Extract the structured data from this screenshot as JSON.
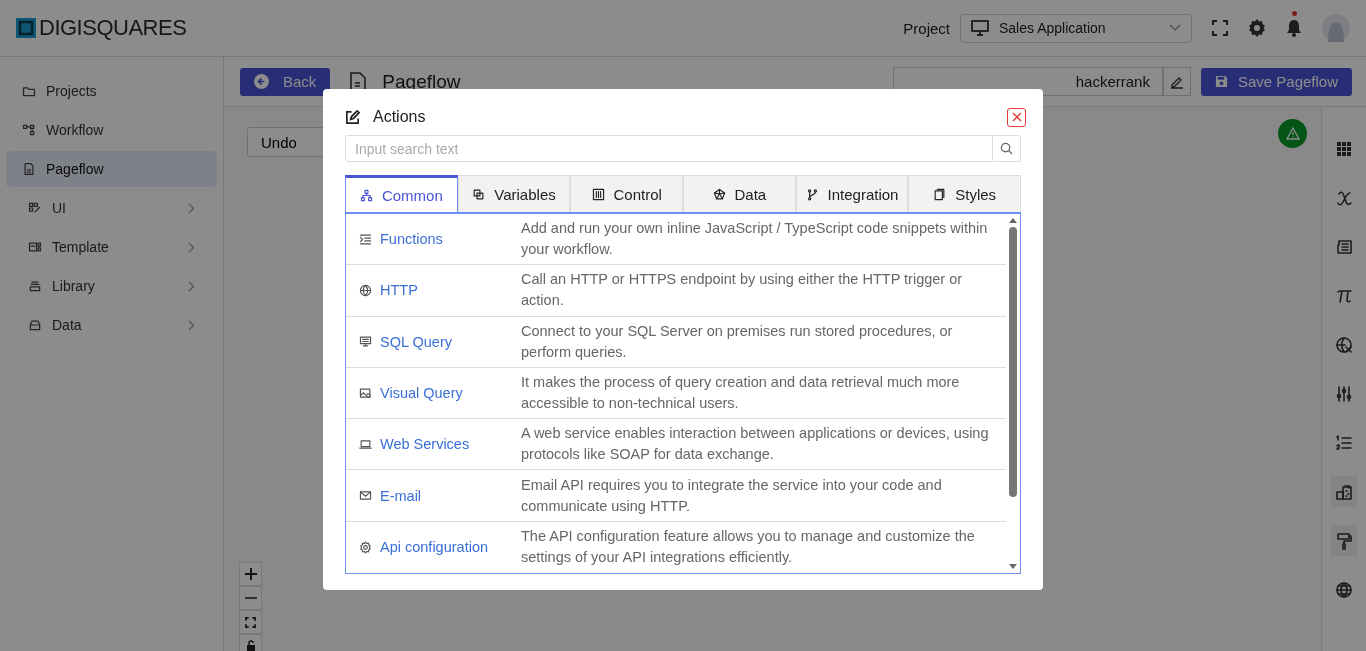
{
  "header": {
    "logo": "DIGISQUARES",
    "project_label": "Project",
    "project_select": "Sales Application",
    "unread_notifications": true
  },
  "sidebar": {
    "items": [
      {
        "label": "Projects",
        "selected": false,
        "expandable": false
      },
      {
        "label": "Workflow",
        "selected": false,
        "expandable": false
      },
      {
        "label": "Pageflow",
        "selected": true,
        "expandable": false
      },
      {
        "label": "UI",
        "selected": false,
        "expandable": true
      },
      {
        "label": "Template",
        "selected": false,
        "expandable": true
      },
      {
        "label": "Library",
        "selected": false,
        "expandable": true
      },
      {
        "label": "Data",
        "selected": false,
        "expandable": true
      }
    ]
  },
  "toolbar": {
    "back": "Back",
    "title": "Pageflow",
    "name_value": "hackerrank",
    "save": "Save Pageflow"
  },
  "canvas": {
    "undo": "Undo"
  },
  "modal": {
    "title": "Actions",
    "search": {
      "placeholder": "Input search text"
    },
    "tabs": [
      {
        "label": "Common",
        "selected": true
      },
      {
        "label": "Variables",
        "selected": false
      },
      {
        "label": "Control",
        "selected": false
      },
      {
        "label": "Data",
        "selected": false
      },
      {
        "label": "Integration",
        "selected": false
      },
      {
        "label": "Styles",
        "selected": false
      }
    ],
    "actions": [
      {
        "name": "Functions",
        "description": "Add and run your own inline JavaScript / TypeScript code snippets within your workflow."
      },
      {
        "name": "HTTP",
        "description": "Call an HTTP or HTTPS endpoint by using either the HTTP trigger or action."
      },
      {
        "name": "SQL Query",
        "description": "Connect to your SQL Server on premises run stored procedures, or perform queries."
      },
      {
        "name": "Visual Query",
        "description": "It makes the process of query creation and data retrieval much more accessible to non-technical users."
      },
      {
        "name": "Web Services",
        "description": "A web service enables interaction between applications or devices, using protocols like SOAP for data exchange."
      },
      {
        "name": "E-mail",
        "description": "Email API requires you to integrate the service into your code and communicate using HTTP."
      },
      {
        "name": "Api configuration",
        "description": "The API configuration feature allows you to manage and customize the settings of your API integrations efficiently."
      }
    ]
  }
}
